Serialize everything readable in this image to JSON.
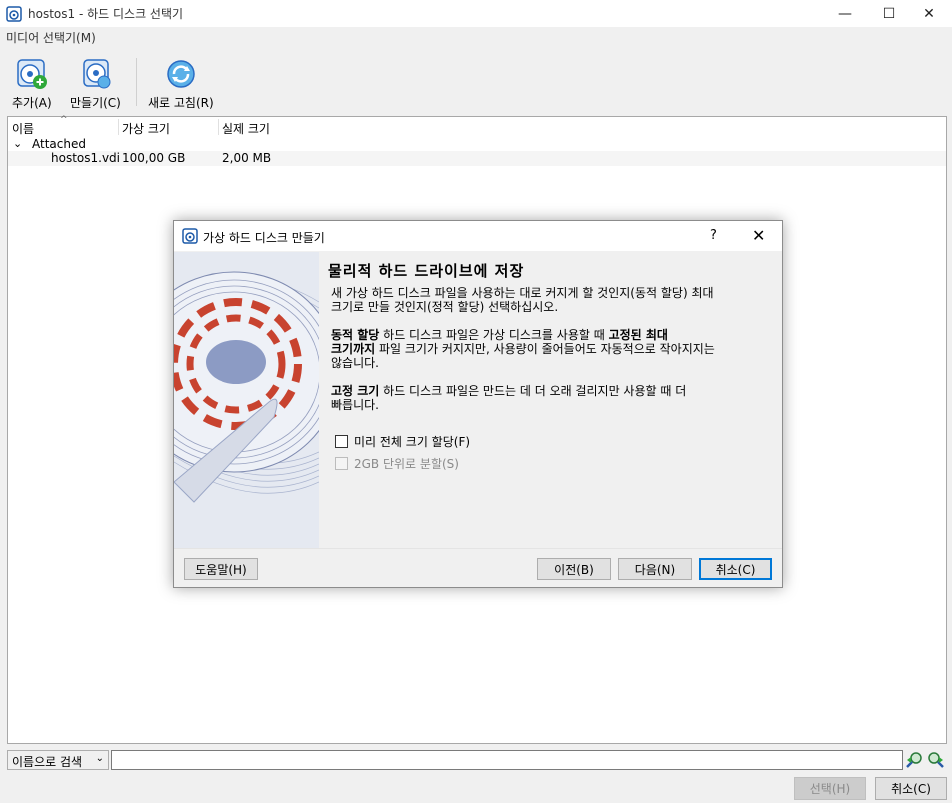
{
  "window": {
    "title": "hostos1 - 하드 디스크 선택기",
    "minimize": "—",
    "maximize": "☐",
    "close": "✕"
  },
  "menubar": {
    "media_selector": "미디어 선택기(M)"
  },
  "toolbar": {
    "add": "추가(A)",
    "create": "만들기(C)",
    "refresh": "새로 고침(R)"
  },
  "list": {
    "columns": [
      "이름",
      "가상 크기",
      "실제 크기"
    ],
    "group_label": "Attached",
    "group_toggle": "⌄",
    "rows": [
      {
        "name": "hostos1.vdi",
        "virtual_size": "100,00 GB",
        "actual_size": "2,00 MB"
      }
    ]
  },
  "search": {
    "mode": "이름으로 검색",
    "arrow": "⌄",
    "value": ""
  },
  "bottom_buttons": {
    "choose": "선택(H)",
    "cancel": "취소(C)"
  },
  "dialog": {
    "title": "가상 하드 디스크 만들기",
    "help_glyph": "?",
    "close_glyph": "✕",
    "heading": "물리적 하드 드라이브에 저장",
    "intro_line1": "새 가상 하드 디스크 파일을 사용하는 대로 커지게 할 것인지(동적 할당) 최대",
    "intro_line2": "크기로 만들 것인지(정적 할당) 선택하십시오.",
    "dynamic_bold": "동적 할당",
    "dynamic_text1": " 하드 디스크 파일은 가상 디스크를 사용할 때 ",
    "dynamic_bold2": "고정된 최대",
    "dynamic_bold3": "크기까지",
    "dynamic_text2": " 파일 크기가 커지지만, 사용량이 줄어들어도 자동적으로 작아지지는",
    "dynamic_text3": "않습니다.",
    "fixed_bold": "고정 크기",
    "fixed_text1": " 하드 디스크 파일은 만드는 데 더 오래 걸리지만 사용할 때 더",
    "fixed_text2": "빠릅니다.",
    "checkbox_preallocate": "미리 전체 크기 할당(F)",
    "checkbox_split": "2GB 단위로 분할(S)",
    "buttons": {
      "help": "도움말(H)",
      "back": "이전(B)",
      "next": "다음(N)",
      "cancel": "취소(C)"
    }
  },
  "colors": {
    "accent": "#0078d7",
    "disk_red": "#c8432f",
    "disk_blue": "#8c9bc4"
  }
}
